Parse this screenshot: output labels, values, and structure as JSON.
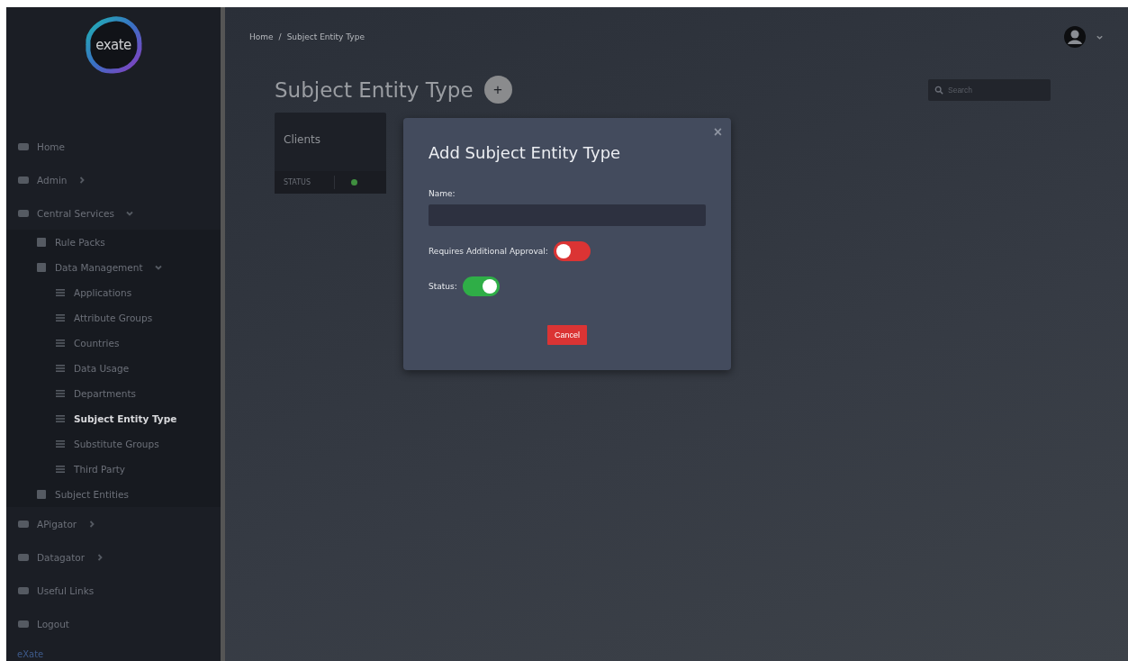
{
  "logo": {
    "text": "exate"
  },
  "nav": [
    {
      "label": "Home",
      "selected": false
    },
    {
      "label": "Admin",
      "selected": false,
      "expanded": false
    },
    {
      "label": "Central Services",
      "selected": false,
      "expanded": true,
      "children": [
        {
          "label": "Rule Packs",
          "selected": false
        },
        {
          "label": "Data Management",
          "selected": false,
          "expanded": true,
          "children": [
            {
              "label": "Applications",
              "selected": false
            },
            {
              "label": "Attribute Groups",
              "selected": false
            },
            {
              "label": "Countries",
              "selected": false
            },
            {
              "label": "Data Usage",
              "selected": false
            },
            {
              "label": "Departments",
              "selected": false
            },
            {
              "label": "Subject Entity Type",
              "selected": true
            },
            {
              "label": "Substitute Groups",
              "selected": false
            },
            {
              "label": "Third Party",
              "selected": false
            }
          ]
        },
        {
          "label": "Subject Entities",
          "selected": false
        }
      ]
    },
    {
      "label": "APigator",
      "selected": false,
      "expanded": false
    },
    {
      "label": "Datagator",
      "selected": false,
      "expanded": false
    },
    {
      "label": "Useful Links",
      "selected": false
    },
    {
      "label": "Logout",
      "selected": false
    }
  ],
  "sidebar_footer": "eXate",
  "breadcrumb": [
    "Home",
    "Subject Entity Type"
  ],
  "breadcrumb_separator": "/",
  "page_title": "Subject Entity Type",
  "add_button": "+",
  "search": {
    "placeholder": "Search"
  },
  "cards": [
    {
      "title": "Clients",
      "status_label": "STATUS",
      "active": true
    }
  ],
  "modal": {
    "title": "Add Subject Entity Type",
    "close": "×",
    "fields": [
      {
        "kind": "text",
        "label": "Name:"
      },
      {
        "kind": "toggle",
        "label": "Requires Additional Approval:",
        "on": false
      },
      {
        "kind": "toggle",
        "label": "Status:",
        "on": true
      }
    ],
    "cancel": "Cancel"
  }
}
